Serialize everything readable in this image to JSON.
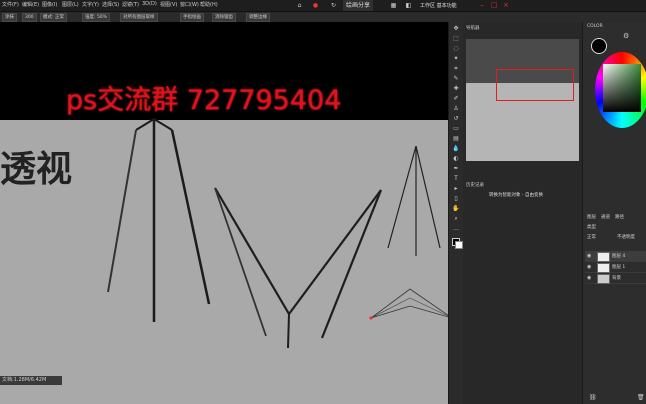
{
  "menubar": {
    "items": [
      "文件(F)",
      "编辑(E)",
      "图像(I)",
      "图层(L)",
      "文字(Y)",
      "选择(S)",
      "滤镜(T)",
      "3D(D)",
      "视图(V)",
      "窗口(W)",
      "帮助(H)"
    ],
    "share_label": "绘画分享",
    "window_title": "工作区 基本功能"
  },
  "optbar": {
    "items": [
      "涂抹",
      "300",
      "模式: 正常",
      "强度: 50%",
      "对所有图层取样",
      "手指绘画",
      "消除锯齿",
      "调整边缘"
    ]
  },
  "canvas": {
    "overlay_text": "ps交流群  727795404",
    "heading": "透视",
    "status": "文档:1.28M/6.42M"
  },
  "tools": {
    "icons": [
      "move-icon",
      "marquee-icon",
      "lasso-icon",
      "magic-wand-icon",
      "crop-icon",
      "eyedropper-icon",
      "healing-icon",
      "brush-icon",
      "stamp-icon",
      "history-brush-icon",
      "eraser-icon",
      "gradient-icon",
      "blur-icon",
      "dodge-icon",
      "pen-icon",
      "type-icon",
      "path-select-icon",
      "shape-icon",
      "hand-icon",
      "zoom-icon",
      "more-icon"
    ]
  },
  "navigator": {
    "tab_label": "导航器"
  },
  "history": {
    "tab_label": "历史记录",
    "item_label": "转换为智能对象 - 自由变换"
  },
  "color": {
    "tab_label": "COLOR"
  },
  "layers": {
    "tabs": [
      "图层",
      "通道",
      "路径"
    ],
    "kind_label": "类型",
    "blend_mode": "正常",
    "opacity_label": "不透明度",
    "rows": [
      {
        "name": "图层 4"
      },
      {
        "name": "图层 1"
      },
      {
        "name": "背景"
      }
    ]
  },
  "colors": {
    "overlay_red": "#e3111d",
    "canvas_gray": "#a9a9a9",
    "panel_dark": "#282828"
  }
}
